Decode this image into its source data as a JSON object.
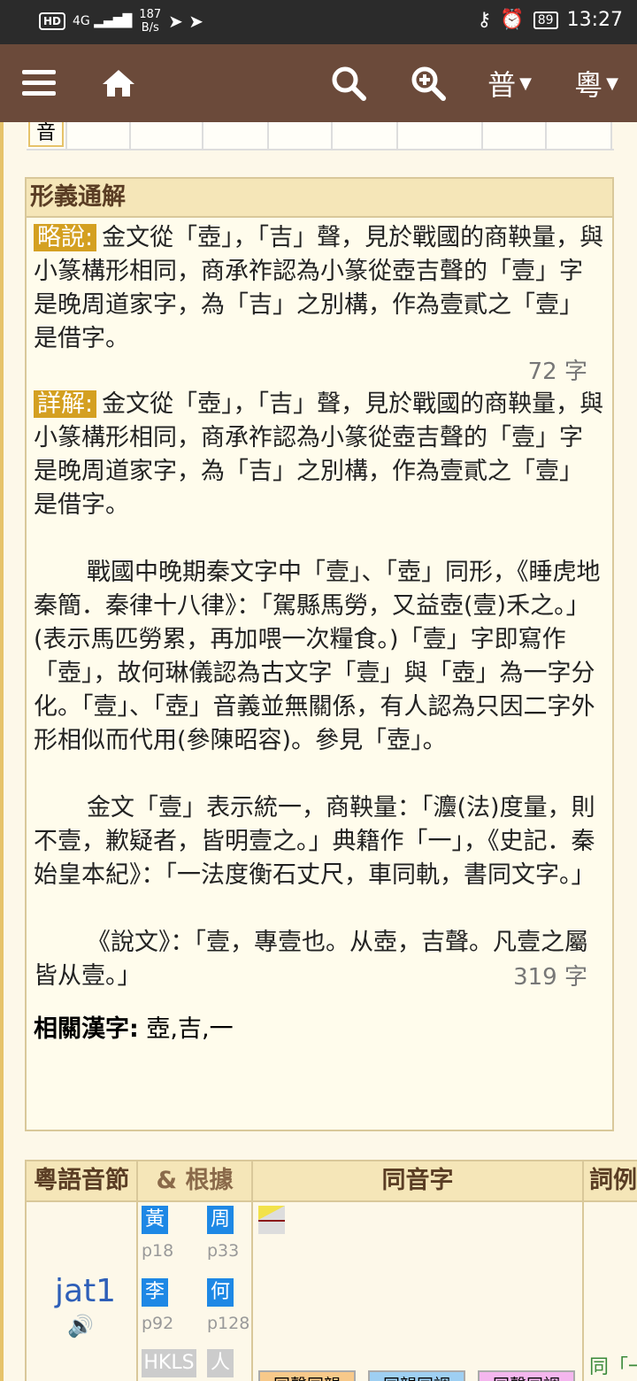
{
  "status": {
    "network": "4G",
    "speed_top": "187",
    "speed_bottom": "B/s",
    "battery": "89",
    "time": "13:27"
  },
  "toolbar": {
    "lang1": "普",
    "lang2": "粵"
  },
  "prev_row_char": "音",
  "section": {
    "title": "形義通解",
    "brief_tag": "略說:",
    "brief_text": "金文從「壺」，「吉」聲，見於戰國的商鞅量，與小篆構形相同，商承祚認為小篆從壺吉聲的「壹」字是晚周道家字，為「吉」之別構，作為壹貳之「壹」是借字。",
    "brief_count": "72 字",
    "detail_tag": "詳解:",
    "detail_text": "金文從「壺」，「吉」聲，見於戰國的商鞅量，與小篆構形相同，商承祚認為小篆從壺吉聲的「壹」字是晚周道家字，為「吉」之別構，作為壹貳之「壹」是借字。",
    "para2": "戰國中晚期秦文字中「壹」、「壺」同形，《睡虎地秦簡．秦律十八律》：「駕縣馬勞，又益壺(壹)禾之。」(表示馬匹勞累，再加喂一次糧食。)「壹」字即寫作「壺」，故何琳儀認為古文字「壹」與「壺」為一字分化。「壹」、「壺」音義並無關係，有人認為只因二字外形相似而代用(參陳昭容)。參見「壺」。",
    "para3": "金文「壹」表示統一，商鞅量：「灋(法)度量，則不壹，歉疑者，皆明壹之。」典籍作「一」，《史記．秦始皇本紀》：「一法度衡石丈尺，車同軌，書同文字。」",
    "para4": "《說文》：「壹，專壹也。从壺，吉聲。凡壹之屬皆从壹。」",
    "detail_count": "319 字",
    "related_label": "相關漢字:",
    "related_value": "壺,吉,一"
  },
  "table": {
    "col1": "粵語音節",
    "col2": "& 根據",
    "col3": "同音字",
    "col4": "詞例",
    "jyutping": "jat1",
    "sources": [
      {
        "name": "黃",
        "page": "p18"
      },
      {
        "name": "周",
        "page": "p33"
      },
      {
        "name": "李",
        "page": "p92"
      },
      {
        "name": "何",
        "page": "p128"
      }
    ],
    "hkls": "HKLS",
    "ren": "人",
    "tag1": "同聲同韻",
    "tag2": "同韻同調",
    "tag3": "同聲同調",
    "tag4": "同「一"
  }
}
